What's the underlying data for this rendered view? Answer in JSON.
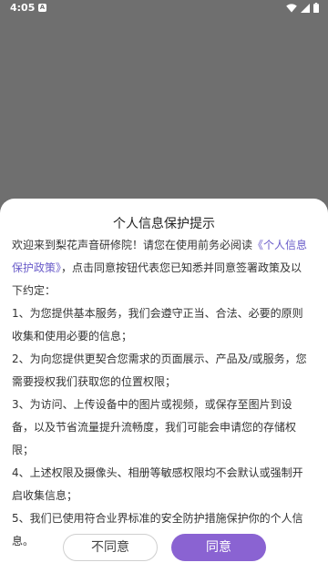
{
  "status_bar": {
    "time": "4:05",
    "notification_glyph": "A",
    "icons": [
      "wifi-icon",
      "cellular-signal-icon",
      "battery-icon"
    ]
  },
  "dialog": {
    "title": "个人信息保护提示",
    "intro_prefix": "欢迎来到梨花声音研修院！请您在使用前务必阅读",
    "policy_link": "《个人信息保护政策》",
    "intro_suffix": "，点击同意按钮代表您已知悉并同意签署政策及以下约定：",
    "items": [
      "1、为您提供基本服务，我们会遵守正当、合法、必要的原则收集和使用必要的信息；",
      "2、为向您提供更契合您需求的页面展示、产品及/或服务，您需要授权我们获取您的位置权限；",
      "3、为访问、上传设备中的图片或视频，或保存至图片到设备，以及节省流量提升流畅度，我们可能会申请您的存储权限；",
      "4、上述权限及摄像头、相册等敏感权限均不会默认或强制开启收集信息；",
      "5、我们已使用符合业界标准的安全防护措施保护你的个人信息。"
    ],
    "disagree_label": "不同意",
    "agree_label": "同意"
  },
  "colors": {
    "accent": "#8a63d2",
    "link": "#6a5cc9",
    "overlay": "#6f6f6f"
  }
}
